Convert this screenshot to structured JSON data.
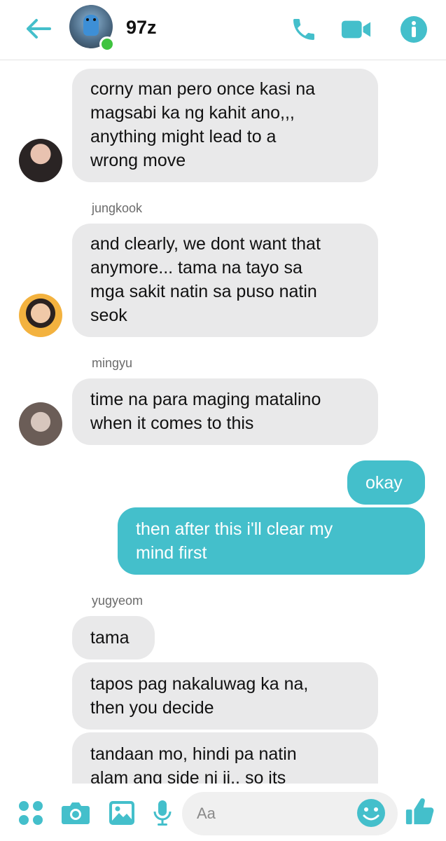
{
  "header": {
    "title": "97z",
    "accent": "#44bfcb"
  },
  "messages": [
    {
      "type": "incoming",
      "text_lines": [
        "corny man pero once kasi na",
        "magsabi ka ng kahit ano,,,",
        "anything might lead to a",
        "wrong move"
      ]
    },
    {
      "type": "incoming",
      "sender": "jungkook",
      "text_lines": [
        "and clearly, we dont want that",
        "anymore... tama na tayo sa",
        "mga sakit natin sa puso natin",
        "seok"
      ]
    },
    {
      "type": "incoming",
      "sender": "mingyu",
      "text_lines": [
        "time na para maging matalino",
        "when it comes to this"
      ]
    },
    {
      "type": "outgoing",
      "text_lines": [
        "okay"
      ]
    },
    {
      "type": "outgoing",
      "text_lines": [
        "then after this i'll clear my",
        "mind first"
      ]
    },
    {
      "type": "incoming",
      "sender": "yugyeom",
      "text_lines": [
        "tama"
      ]
    },
    {
      "type": "incoming",
      "text_lines": [
        "tapos pag nakaluwag ka na,",
        "then you decide"
      ]
    },
    {
      "type": "incoming",
      "text_lines": [
        "tandaan mo, hindi pa natin",
        "alam ang side ni ji.. so its"
      ]
    }
  ],
  "composer": {
    "placeholder": "Aa"
  },
  "icons": {
    "back": "back-arrow-icon",
    "call": "phone-icon",
    "video": "video-camera-icon",
    "info": "info-icon",
    "more": "four-dots-icon",
    "camera": "camera-icon",
    "gallery": "image-icon",
    "mic": "microphone-icon",
    "emoji": "smiley-icon",
    "like": "thumbs-up-icon"
  }
}
